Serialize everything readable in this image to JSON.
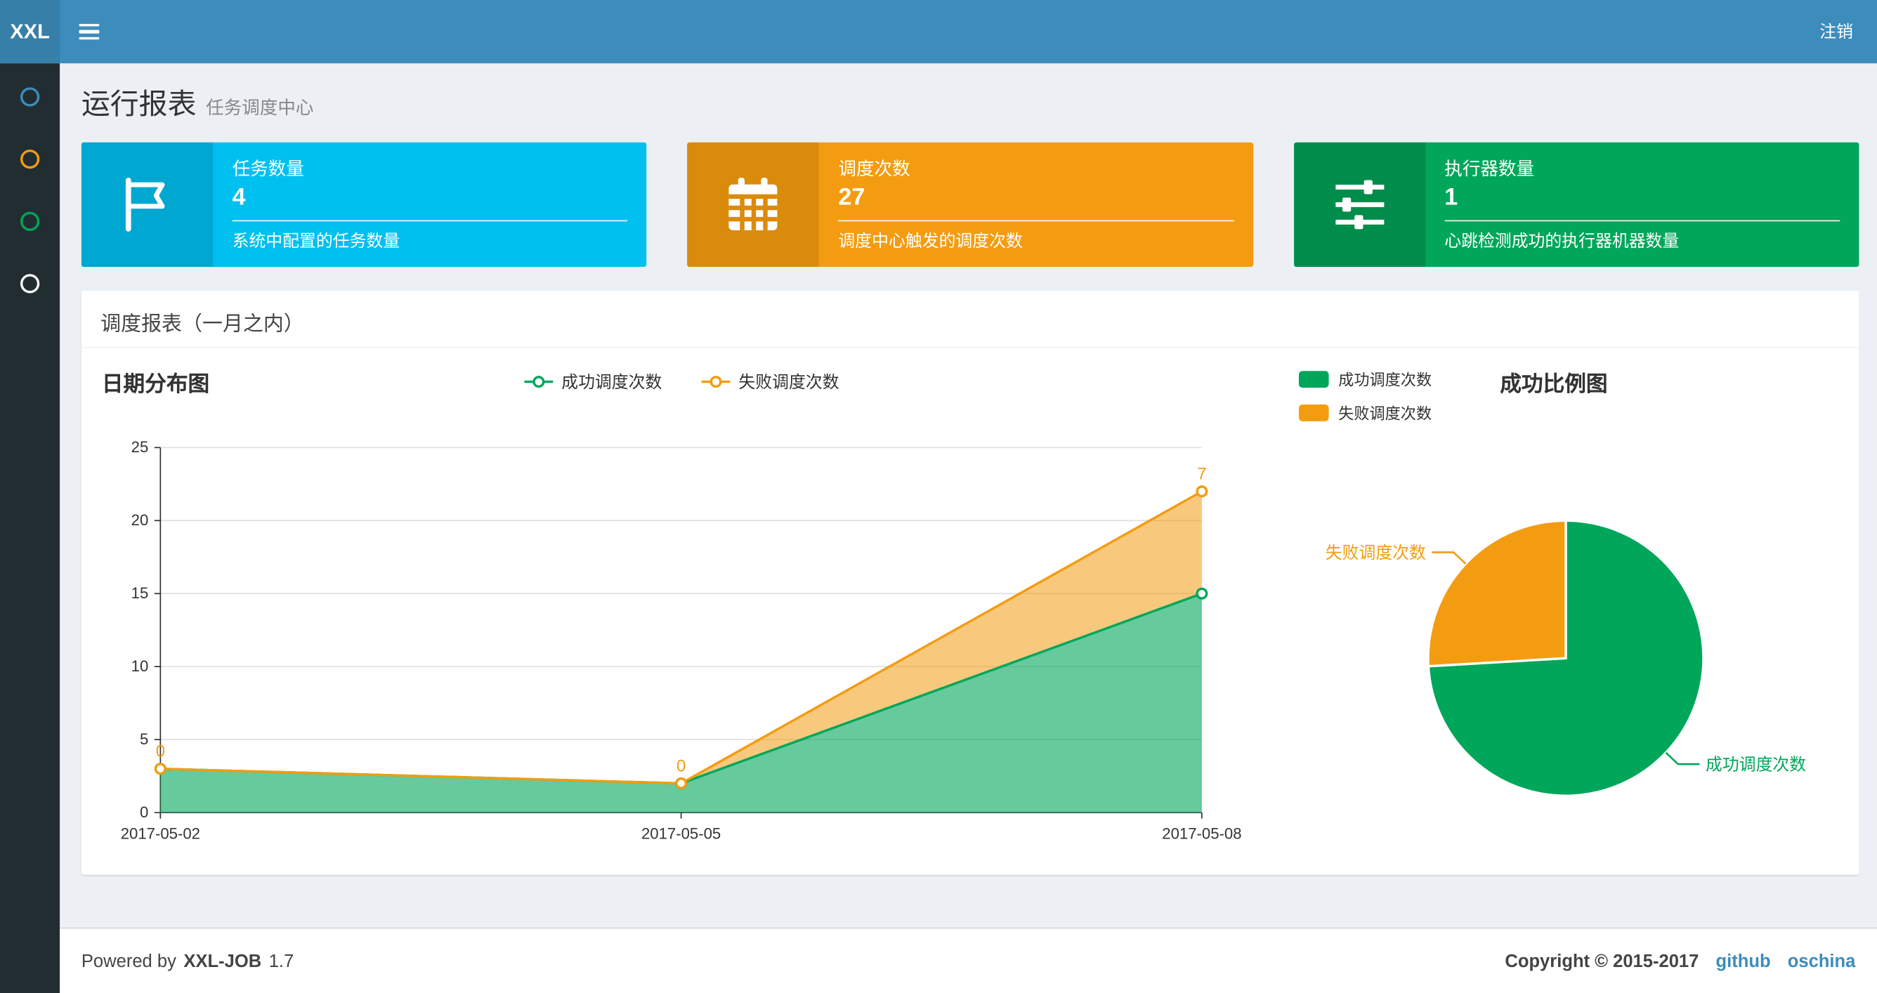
{
  "navbar": {
    "logo": "XXL",
    "logout_label": "注销"
  },
  "sidebar": {
    "items": [
      {
        "icon": "circle-icon",
        "color": "#3c8dbc"
      },
      {
        "icon": "circle-icon",
        "color": "#f39c12"
      },
      {
        "icon": "circle-icon",
        "color": "#00a65a"
      },
      {
        "icon": "circle-icon",
        "color": "#ffffff"
      }
    ]
  },
  "page_header": {
    "title": "运行报表",
    "subtitle": "任务调度中心"
  },
  "info_boxes": [
    {
      "icon": "flag-icon",
      "label": "任务数量",
      "value": "4",
      "desc": "系统中配置的任务数量",
      "color": "#00c0ef",
      "icon_bg": "#00a7d0"
    },
    {
      "icon": "calendar-icon",
      "label": "调度次数",
      "value": "27",
      "desc": "调度中心触发的调度次数",
      "color": "#f39c12",
      "icon_bg": "#db8b0b"
    },
    {
      "icon": "sliders-icon",
      "label": "执行器数量",
      "value": "1",
      "desc": "心跳检测成功的执行器机器数量",
      "color": "#00a65a",
      "icon_bg": "#008d4c"
    }
  ],
  "panel": {
    "title": "调度报表（一月之内）"
  },
  "chart_data": [
    {
      "type": "area",
      "title": "日期分布图",
      "stacked": true,
      "x": [
        "2017-05-02",
        "2017-05-05",
        "2017-05-08"
      ],
      "series": [
        {
          "name": "成功调度次数",
          "color": "#00a65a",
          "values": [
            3,
            2,
            15
          ]
        },
        {
          "name": "失败调度次数",
          "color": "#f39c12",
          "values": [
            0,
            0,
            7
          ],
          "data_labels": true
        }
      ],
      "ylim": [
        0,
        25
      ],
      "yticks": [
        0,
        5,
        10,
        15,
        20,
        25
      ],
      "grid": true,
      "legend_position": "top-center"
    },
    {
      "type": "pie",
      "title": "成功比例图",
      "slices": [
        {
          "name": "成功调度次数",
          "value": 20,
          "color": "#00a65a"
        },
        {
          "name": "失败调度次数",
          "value": 7,
          "color": "#f39c12"
        }
      ],
      "start_angle": 90,
      "direction": "clockwise",
      "legend_position": "top-left"
    }
  ],
  "footer": {
    "powered_by": "Powered by",
    "product": "XXL-JOB",
    "version": "1.7",
    "copyright": "Copyright © 2015-2017",
    "links": [
      "github",
      "oschina"
    ]
  }
}
